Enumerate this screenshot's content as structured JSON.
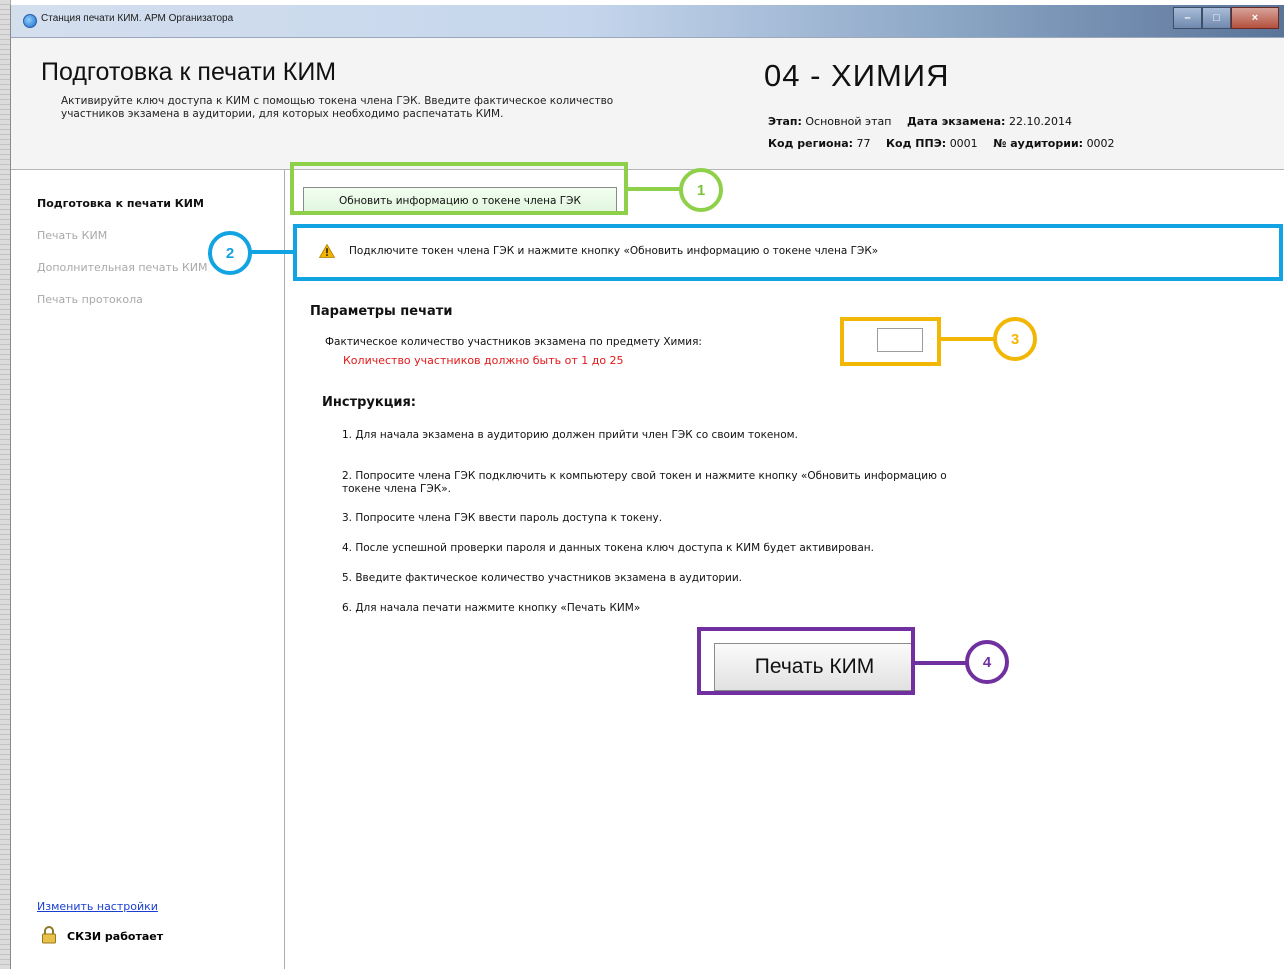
{
  "window": {
    "title": "Станция печати КИМ. АРМ Организатора",
    "controls": {
      "minimize": "–",
      "maximize": "□",
      "close": "×"
    }
  },
  "header": {
    "title": "Подготовка к печати КИМ",
    "description_line1": "Активируйте ключ доступа к КИМ с помощью токена члена ГЭК. Введите фактическое количество",
    "description_line2": "участников экзамена в аудитории, для которых необходимо распечатать КИМ.",
    "subject": "04 - ХИМИЯ",
    "stage_label": "Этап:",
    "stage_value": "Основной этап",
    "exam_date_label": "Дата экзамена:",
    "exam_date_value": "22.10.2014",
    "region_label": "Код региона:",
    "region_value": "77",
    "ppe_label": "Код ППЭ:",
    "ppe_value": "0001",
    "room_label": "№ аудитории:",
    "room_value": "0002"
  },
  "sidebar": {
    "items": [
      {
        "label": "Подготовка к печати КИМ",
        "active": true
      },
      {
        "label": "Печать КИМ",
        "active": false
      },
      {
        "label": "Дополнительная печать КИМ",
        "active": false
      },
      {
        "label": "Печать протокола",
        "active": false
      }
    ],
    "settings_link": "Изменить настройки",
    "status_label": "СКЗИ работает"
  },
  "main": {
    "update_button": "Обновить информацию о токене члена ГЭК",
    "warning_text": "Подключите токен члена ГЭК и нажмите кнопку «Обновить информацию о токене члена ГЭК»",
    "params_title": "Параметры печати",
    "participants_label": "Фактическое количество участников экзамена по предмету Химия:",
    "participants_value": "",
    "participants_error": "Количество участников должно быть от 1 до 25",
    "instructions_title": "Инструкция:",
    "instructions": [
      "1. Для начала экзамена в аудиторию должен прийти член ГЭК со своим токеном.",
      "2. Попросите члена ГЭК подключить к компьютеру свой токен и нажмите кнопку «Обновить информацию о токене члена ГЭК».",
      "3. Попросите члена ГЭК ввести пароль доступа к токену.",
      "4. После успешной проверки пароля и данных токена ключ доступа к КИМ будет активирован.",
      "5. Введите фактическое количество участников экзамена в аудитории.",
      "6. Для начала печати нажмите кнопку «Печать КИМ»"
    ],
    "print_button": "Печать КИМ"
  },
  "annotations": {
    "callout_1": "1",
    "callout_2": "2",
    "callout_3": "3",
    "callout_4": "4",
    "colors": {
      "green": "#8ed04a",
      "blue": "#11a3e2",
      "yellow": "#f2b705",
      "purple": "#7030a0"
    }
  },
  "icons": {
    "app": "app-icon",
    "warning": "warning-icon",
    "lock": "lock-icon"
  }
}
